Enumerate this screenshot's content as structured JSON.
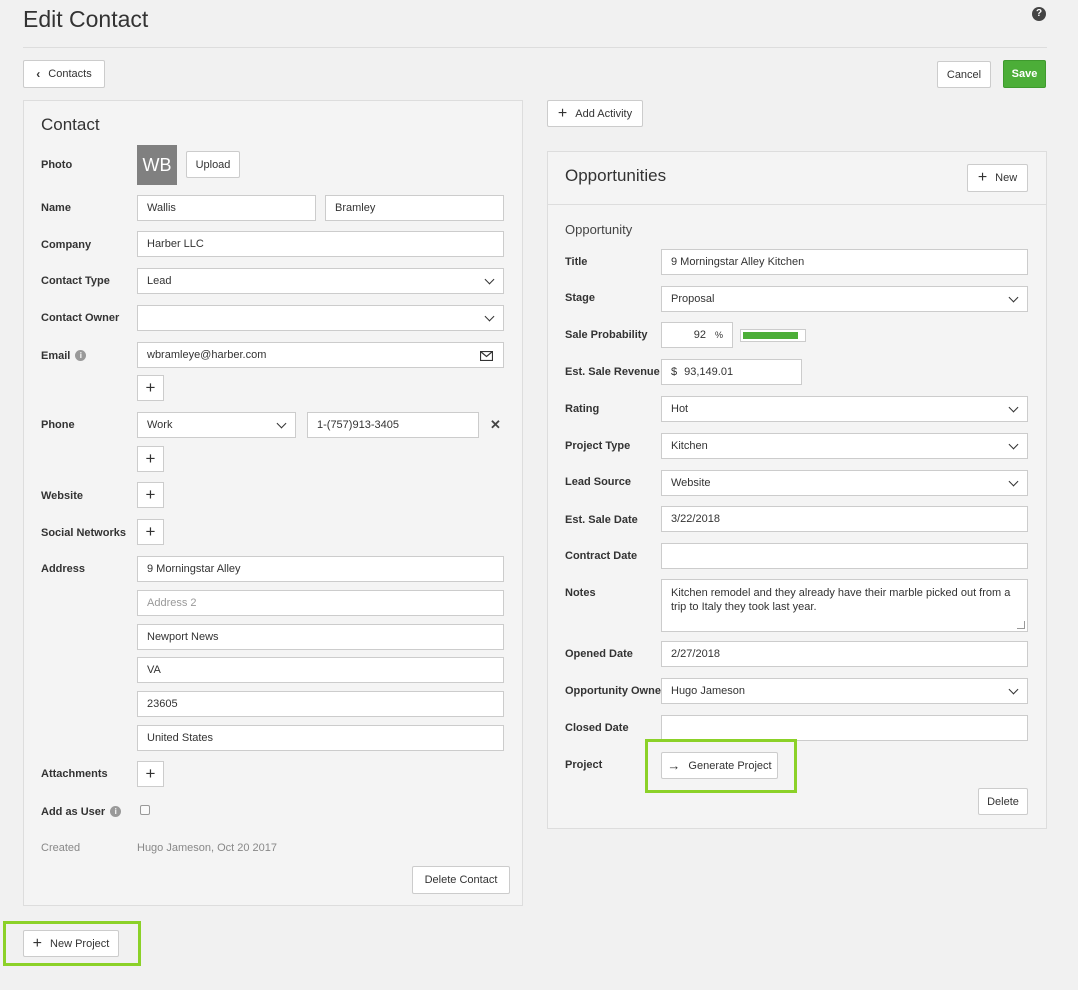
{
  "page": {
    "title": "Edit Contact",
    "help_icon": "question-circle-icon"
  },
  "toolbar": {
    "back_label": "Contacts",
    "cancel_label": "Cancel",
    "save_label": "Save",
    "accent": "#4cae38"
  },
  "contact": {
    "heading": "Contact",
    "photo_label": "Photo",
    "avatar_initials": "WB",
    "upload_label": "Upload",
    "name_label": "Name",
    "first_name": "Wallis",
    "last_name": "Bramley",
    "company_label": "Company",
    "company": "Harber LLC",
    "contact_type_label": "Contact Type",
    "contact_type": "Lead",
    "contact_owner_label": "Contact Owner",
    "contact_owner": "",
    "email_label": "Email",
    "email": "wbramleye@harber.com",
    "phone_label": "Phone",
    "phone_type": "Work",
    "phone": "1-(757)913-3405",
    "website_label": "Website",
    "social_label": "Social Networks",
    "address_label": "Address",
    "address1": "9 Morningstar Alley",
    "address2_placeholder": "Address 2",
    "city": "Newport News",
    "state": "VA",
    "zip": "23605",
    "country": "United States",
    "attachments_label": "Attachments",
    "add_as_user_label": "Add as User",
    "created_label": "Created",
    "created_value": "Hugo Jameson, Oct 20 2017",
    "delete_label": "Delete Contact"
  },
  "activity": {
    "add_label": "Add Activity"
  },
  "opportunities": {
    "heading": "Opportunities",
    "new_label": "New",
    "sub_heading": "Opportunity",
    "title_label": "Title",
    "title": "9 Morningstar Alley Kitchen",
    "stage_label": "Stage",
    "stage": "Proposal",
    "probability_label": "Sale Probability",
    "probability": "92",
    "probability_unit": "%",
    "probability_fraction": 0.92,
    "revenue_label": "Est. Sale Revenue",
    "revenue_currency": "$",
    "revenue": "93,149.01",
    "rating_label": "Rating",
    "rating": "Hot",
    "project_type_label": "Project Type",
    "project_type": "Kitchen",
    "lead_source_label": "Lead Source",
    "lead_source": "Website",
    "sale_date_label": "Est. Sale Date",
    "sale_date": "3/22/2018",
    "contract_date_label": "Contract Date",
    "contract_date": "",
    "notes_label": "Notes",
    "notes": "Kitchen remodel and they already have their marble picked out from a trip to Italy they took last year.",
    "opened_date_label": "Opened Date",
    "opened_date": "2/27/2018",
    "owner_label": "Opportunity Owner",
    "owner": "Hugo Jameson",
    "closed_date_label": "Closed Date",
    "closed_date": "",
    "project_label": "Project",
    "generate_label": "Generate Project",
    "delete_label": "Delete"
  },
  "footer": {
    "new_project_label": "New Project",
    "highlight_color": "#8bd128"
  }
}
